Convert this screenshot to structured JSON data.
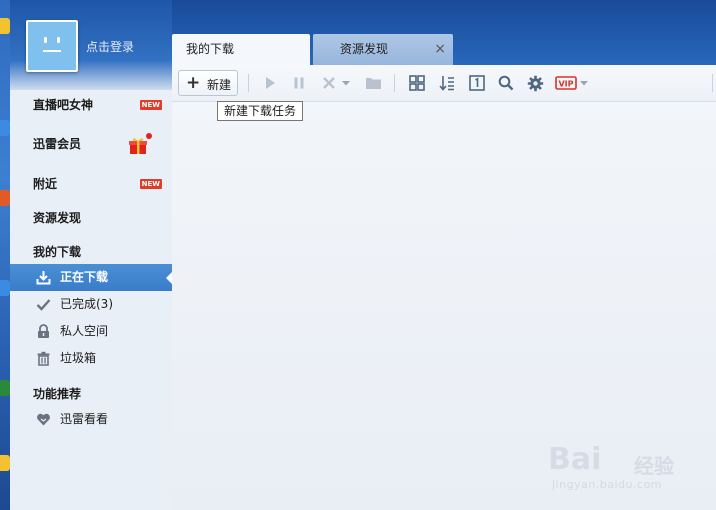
{
  "app": {
    "login_text": "点击登录"
  },
  "sidebar": {
    "items": [
      {
        "label": "直播吧女神",
        "badge": "NEW"
      },
      {
        "label": "迅雷会员"
      },
      {
        "label": "附近",
        "badge": "NEW"
      },
      {
        "label": "资源发现"
      }
    ],
    "downloads_title": "我的下载",
    "download_items": [
      {
        "label": "正在下载",
        "icon": "download-icon",
        "active": true
      },
      {
        "label": "已完成(3)",
        "icon": "check-icon"
      },
      {
        "label": "私人空间",
        "icon": "lock-icon"
      },
      {
        "label": "垃圾箱",
        "icon": "trash-icon"
      }
    ],
    "features_title": "功能推荐",
    "feature_items": [
      {
        "label": "迅雷看看",
        "icon": "heart-icon"
      }
    ]
  },
  "tabs": [
    {
      "label": "我的下载",
      "active": true
    },
    {
      "label": "资源发现",
      "active": false
    }
  ],
  "toolbar": {
    "new_label": "新建",
    "tooltip": "新建下载任务",
    "vip_label": "VIP"
  },
  "watermark": {
    "brand": "Bai",
    "brand2": "经验",
    "url": "jingyan.baidu.com"
  },
  "colors": {
    "accent": "#3a7cc9",
    "badge": "#e03c2a",
    "frame": "#2766b8"
  }
}
